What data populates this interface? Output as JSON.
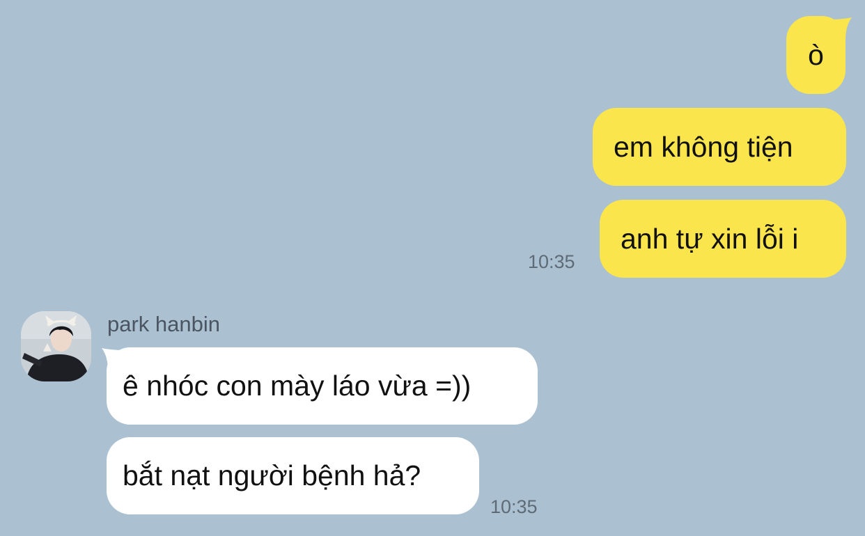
{
  "theme": {
    "background": "#abc1d1",
    "sent_bubble": "#fbe54d",
    "received_bubble": "#ffffff",
    "timestamp_color": "#5e6b77"
  },
  "outgoing": {
    "messages": [
      {
        "text": "ò"
      },
      {
        "text": "em không tiện"
      },
      {
        "text": "anh tự xin lỗi i"
      }
    ],
    "timestamp": "10:35"
  },
  "incoming": {
    "sender_name": "park hanbin",
    "avatar_icon": "profile-photo",
    "messages": [
      {
        "text": "ê nhóc con mày láo vừa =))"
      },
      {
        "text": "bắt nạt người bệnh hả?"
      }
    ],
    "timestamp": "10:35"
  }
}
